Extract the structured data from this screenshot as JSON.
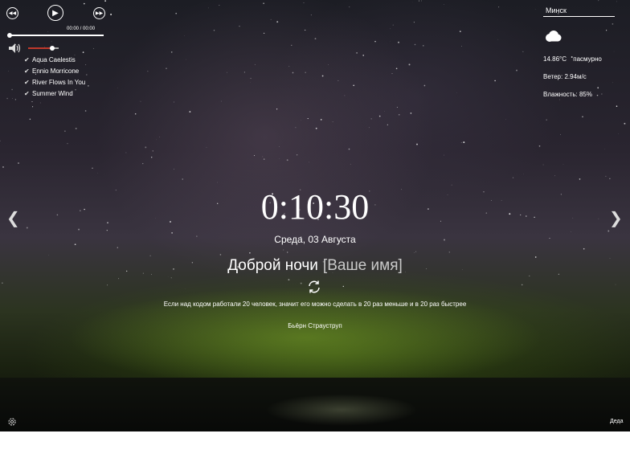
{
  "player": {
    "timecode": "00:00 / 00:00",
    "progress_fraction": 0,
    "volume_fraction": 0.8,
    "playlist": [
      "Aqua Caelestis",
      "Ennio Morricone",
      "River Flows In You",
      "Summer Wind"
    ],
    "icons": {
      "prev": "prev-icon",
      "play": "play-icon",
      "next": "next-icon",
      "volume": "volume-icon",
      "check": "check-icon"
    }
  },
  "weather": {
    "city": "Минск",
    "temperature": "14.86°C",
    "description": "пасмурно",
    "wind": "Ветер: 2.94м/с",
    "humidity": "Влажность: 85%",
    "icon": "cloud-icon"
  },
  "clock": {
    "time": "0:10:30",
    "date": "Среда, 03 Августа"
  },
  "greeting": {
    "text": "Доброй ночи",
    "name_placeholder": "[Ваше имя]"
  },
  "quote": {
    "text": "Если над кодом работали 20 человек, значит его можно сделать в 20 раз меньше и в 20 раз быстрее",
    "author": "Бьёрн Страуструп"
  },
  "footer": {
    "language": "Деда"
  },
  "icons": {
    "slider_prev": "chevron-left-icon",
    "slider_next": "chevron-right-icon",
    "refresh": "refresh-icon",
    "settings": "gear-icon"
  }
}
